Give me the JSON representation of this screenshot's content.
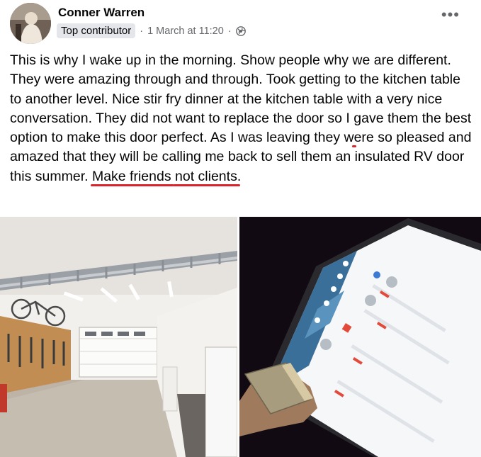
{
  "post": {
    "author": "Conner Warren",
    "badge": "Top contributor",
    "timestamp": "1 March at 11:20",
    "separator": "·",
    "privacy_icon": "globe-icon",
    "more_icon": "more-options-icon",
    "more_label": "•••",
    "text": {
      "t1": "This is why I wake up in the morning. Show people why we are different. They were amazing through and through. Took getting to the kitchen table to another level. Nice stir fry dinner at the kitchen table with a very nice conversation. They did not want to replace the door so I ",
      "h1": "gave them the best option to make this door perfect",
      "t2": ". As I was leaving they were so pleased and amazed that they will be calling me back to sell them an insulated RV door this summer. ",
      "h2a": "Make friends",
      "h2b": "not clients",
      "t3": "."
    },
    "highlight_color": "#d9232d"
  }
}
